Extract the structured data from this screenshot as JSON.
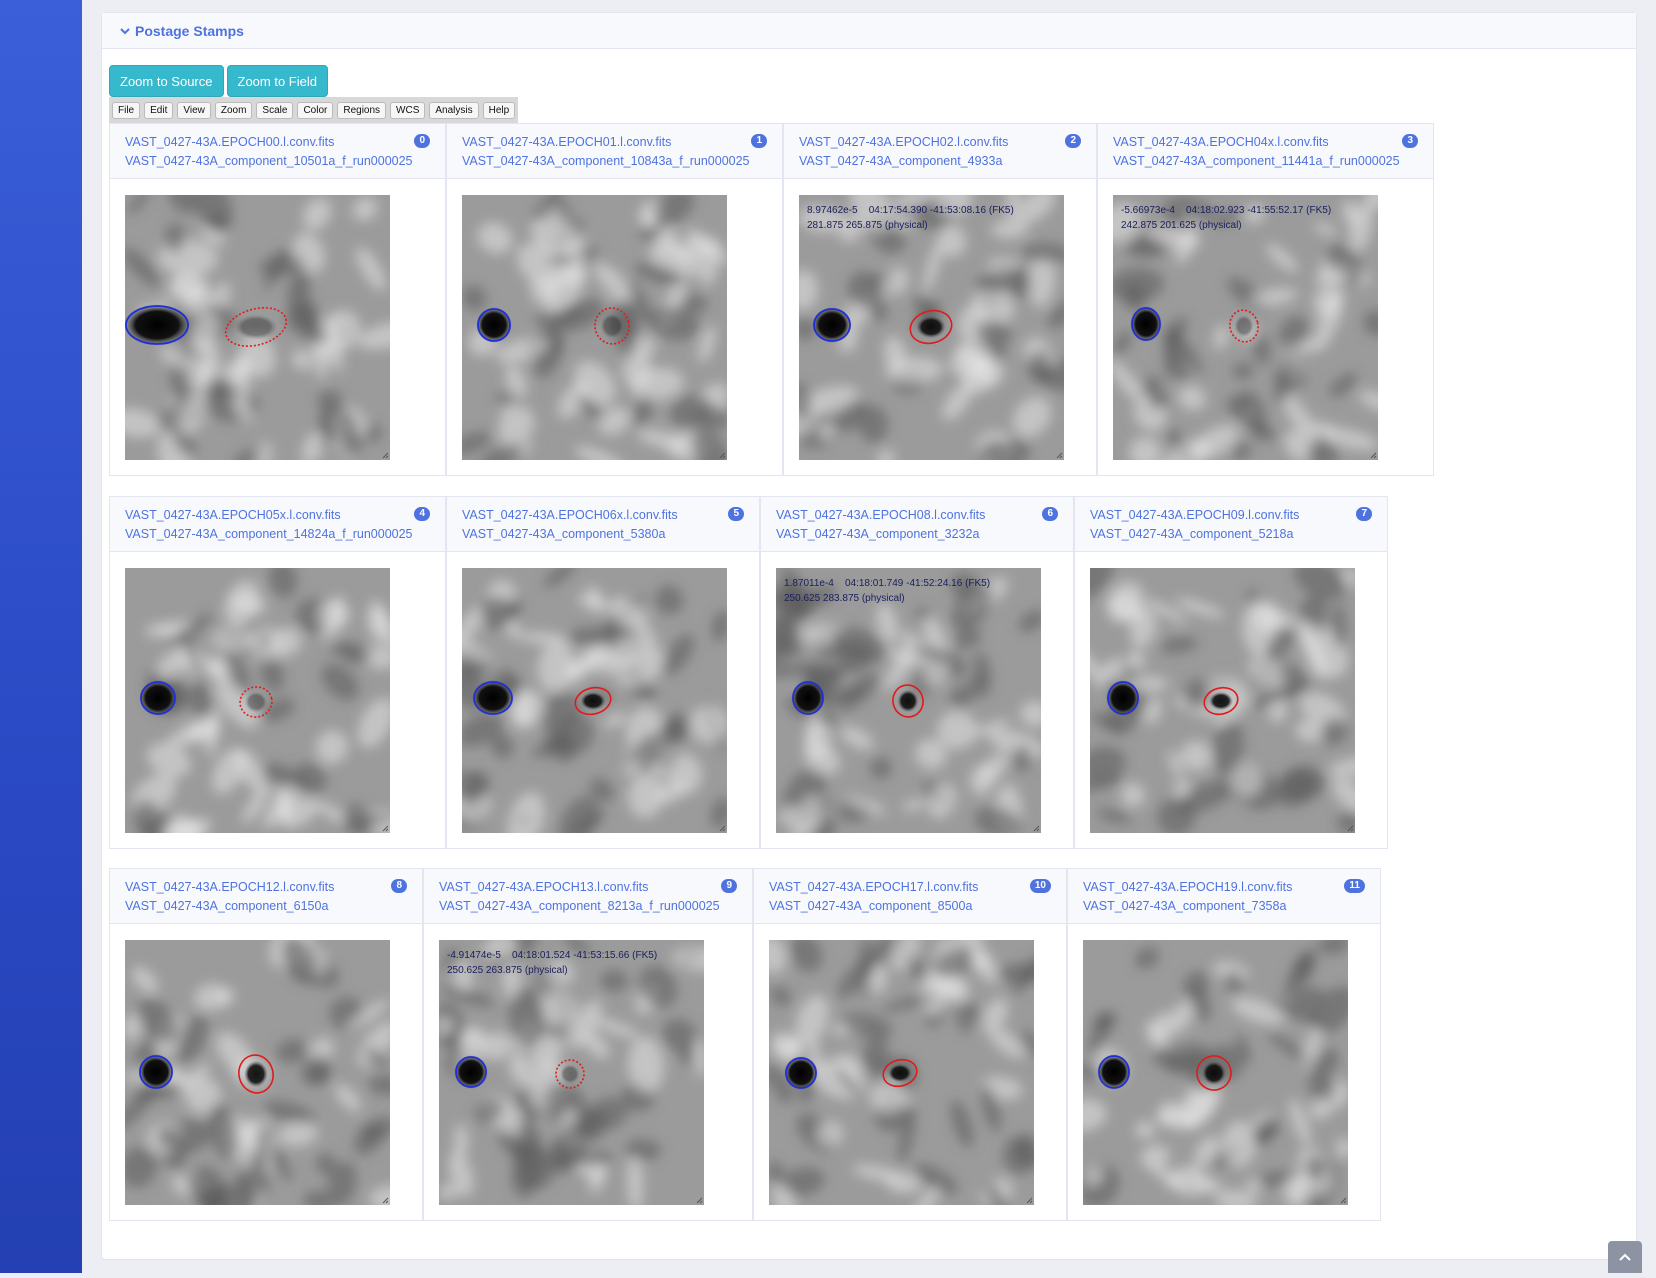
{
  "card": {
    "title": "Postage Stamps"
  },
  "buttons": {
    "zoom_source": "Zoom to Source",
    "zoom_field": "Zoom to Field"
  },
  "menu": [
    "File",
    "Edit",
    "View",
    "Zoom",
    "Scale",
    "Color",
    "Regions",
    "WCS",
    "Analysis",
    "Help"
  ],
  "colors": {
    "sidebar": "#2f52cf",
    "accent": "#4e73df",
    "button": "#36b9cc",
    "region_blue": "#1f2fd6",
    "region_red": "#e01b1b"
  },
  "panels": [
    {
      "file": "VAST_0427-43A.EPOCH00.l.conv.fits",
      "component": "VAST_0427-43A_component_10501a_f_run000025",
      "badge": "0",
      "coords": "",
      "red_style": "dashed"
    },
    {
      "file": "VAST_0427-43A.EPOCH01.l.conv.fits",
      "component": "VAST_0427-43A_component_10843a_f_run000025",
      "badge": "1",
      "coords": "",
      "red_style": "dashed"
    },
    {
      "file": "VAST_0427-43A.EPOCH02.l.conv.fits",
      "component": "VAST_0427-43A_component_4933a",
      "badge": "2",
      "coords": "8.97462e-5    04:17:54.390 -41:53:08.16 (FK5)    281.875 265.875 (physical)",
      "red_style": "solid"
    },
    {
      "file": "VAST_0427-43A.EPOCH04x.l.conv.fits",
      "component": "VAST_0427-43A_component_11441a_f_run000025",
      "badge": "3",
      "coords": "-5.66973e-4    04:18:02.923 -41:55:52.17 (FK5)    242.875 201.625 (physical)",
      "red_style": "dashed"
    },
    {
      "file": "VAST_0427-43A.EPOCH05x.l.conv.fits",
      "component": "VAST_0427-43A_component_14824a_f_run000025",
      "badge": "4",
      "coords": "",
      "red_style": "dashed"
    },
    {
      "file": "VAST_0427-43A.EPOCH06x.l.conv.fits",
      "component": "VAST_0427-43A_component_5380a",
      "badge": "5",
      "coords": "",
      "red_style": "solid"
    },
    {
      "file": "VAST_0427-43A.EPOCH08.l.conv.fits",
      "component": "VAST_0427-43A_component_3232a",
      "badge": "6",
      "coords": "1.87011e-4    04:18:01.749 -41:52:24.16 (FK5)    250.625 283.875 (physical)",
      "red_style": "solid"
    },
    {
      "file": "VAST_0427-43A.EPOCH09.l.conv.fits",
      "component": "VAST_0427-43A_component_5218a",
      "badge": "7",
      "coords": "",
      "red_style": "solid"
    },
    {
      "file": "VAST_0427-43A.EPOCH12.l.conv.fits",
      "component": "VAST_0427-43A_component_6150a",
      "badge": "8",
      "coords": "",
      "red_style": "solid"
    },
    {
      "file": "VAST_0427-43A.EPOCH13.l.conv.fits",
      "component": "VAST_0427-43A_component_8213a_f_run000025",
      "badge": "9",
      "coords": "-4.91474e-5    04:18:01.524 -41:53:15.66 (FK5)    250.625 263.875 (physical)",
      "red_style": "dashed"
    },
    {
      "file": "VAST_0427-43A.EPOCH17.l.conv.fits",
      "component": "VAST_0427-43A_component_8500a",
      "badge": "10",
      "coords": "",
      "red_style": "solid"
    },
    {
      "file": "VAST_0427-43A.EPOCH19.l.conv.fits",
      "component": "VAST_0427-43A_component_7358a",
      "badge": "11",
      "coords": "",
      "red_style": "solid"
    }
  ]
}
